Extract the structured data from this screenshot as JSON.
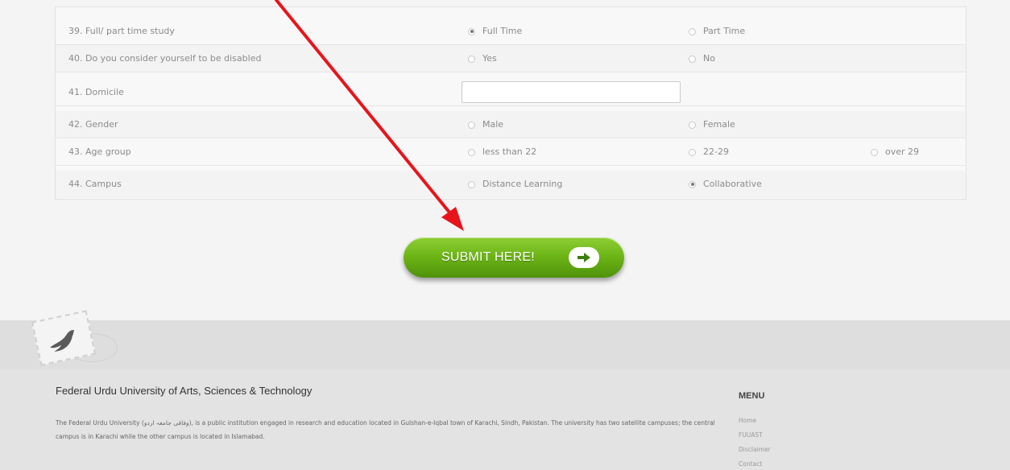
{
  "form": {
    "rows": [
      {
        "label": "39. Full/ part time study",
        "options": [
          "Full Time",
          "Part Time"
        ],
        "selected": 0
      },
      {
        "label": "40. Do you consider yourself to be disabled",
        "options": [
          "Yes",
          "No"
        ],
        "selected": -1
      },
      {
        "label": "41. Domicile",
        "input_value": ""
      },
      {
        "label": "42. Gender",
        "options": [
          "Male",
          "Female"
        ],
        "selected": -1
      },
      {
        "label": "43. Age group",
        "options": [
          "less than 22",
          "22-29",
          "over 29"
        ],
        "selected": -1
      },
      {
        "label": "44. Campus",
        "options": [
          "Distance Learning",
          "Collaborative"
        ],
        "selected": 1
      }
    ]
  },
  "submit": {
    "label": "SUBMIT HERE!"
  },
  "footer": {
    "title": "Federal Urdu University of Arts, Sciences & Technology",
    "paragraph_1": "The Federal Urdu University (وفاقی جامعہ اردو), is a public institution engaged in research and education located in Gulshan-e-Iqbal town of Karachi, Sindh, Pakistan. The university has two satellite campuses; the central campus is in Karachi while the other campus is located in Islamabad.",
    "menu_title": "MENU",
    "menu_items": [
      "Home",
      "FUUAST",
      "Disclaimer",
      "Contact"
    ]
  },
  "annotation": {
    "arrow_color": "#e8141b"
  },
  "colors": {
    "accent_green": "#6cb416"
  }
}
